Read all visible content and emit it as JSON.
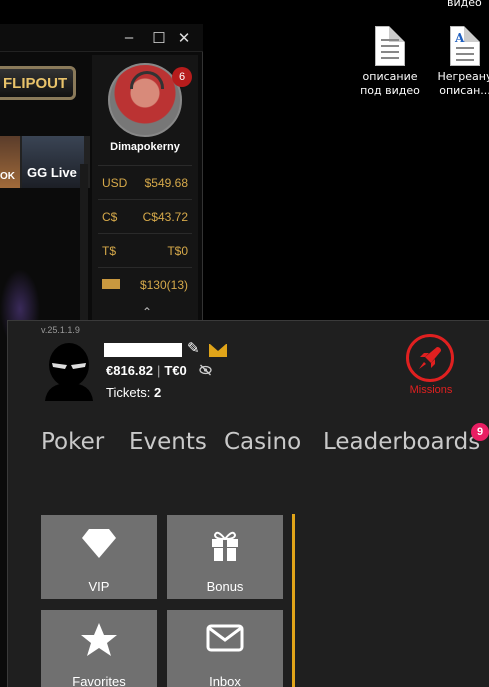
{
  "desktop": {
    "top_label": "видео",
    "icons": [
      {
        "line1": "описание",
        "line2": "под видео"
      },
      {
        "line1": "Негреану",
        "line2": "описан..."
      }
    ]
  },
  "background_window": {
    "promo_label": "FLIPOUT",
    "thumb_labels": [
      "OK",
      "GG Live"
    ],
    "window_controls": [
      "–",
      "☐",
      "✕"
    ]
  },
  "profile": {
    "username": "Dimapokerny",
    "notification_count": "6",
    "balances": [
      {
        "currency": "USD",
        "amount": "$549.68"
      },
      {
        "currency": "C$",
        "amount": "C$43.72"
      },
      {
        "currency": "T$",
        "amount": "T$0"
      },
      {
        "currency": "",
        "amount": "$130(13)",
        "icon": "ticket-icon"
      }
    ]
  },
  "panel": {
    "version": "v.25.1.1.9",
    "balance_eur": "€816.82",
    "balance_t": "T€0",
    "tickets_label": "Tickets:",
    "tickets_count": "2",
    "missions_label": "Missions",
    "nav": [
      "Poker",
      "Events",
      "Casino",
      "Leaderboards"
    ],
    "leaderboards_badge": "9",
    "tiles": [
      {
        "label": "VIP",
        "icon": "diamond-icon"
      },
      {
        "label": "Bonus",
        "icon": "gift-icon"
      },
      {
        "label": "Favorites",
        "icon": "star-icon"
      },
      {
        "label": "Inbox",
        "icon": "mail-icon"
      }
    ],
    "accent_color": "#e0a419",
    "missions_color": "#e02020",
    "badge_color": "#e91e63"
  }
}
